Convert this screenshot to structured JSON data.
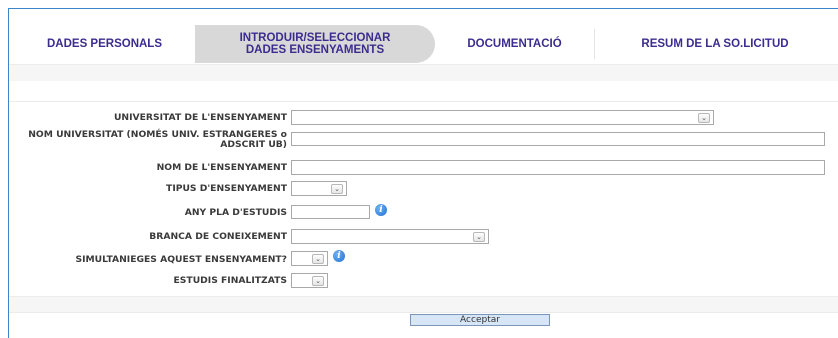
{
  "tabs": [
    {
      "label_line1": "DADES PERSONALS",
      "label_line2": ""
    },
    {
      "label_line1": "INTRODUIR/SELECCIONAR",
      "label_line2": "DADES ENSENYAMENTS"
    },
    {
      "label_line1": "DOCUMENTACIÓ",
      "label_line2": ""
    },
    {
      "label_line1": "RESUM DE LA SO.LICITUD",
      "label_line2": ""
    }
  ],
  "active_tab_index": 1,
  "form": {
    "universitat_label": "UNIVERSITAT DE L'ENSENYAMENT",
    "universitat_value": "",
    "nom_universitat_label_line1": "NOM UNIVERSITAT (NOMÉS UNIV. ESTRANGERES o",
    "nom_universitat_label_line2": "ADSCRIT UB)",
    "nom_universitat_value": "",
    "nom_ensenyament_label": "NOM DE L'ENSENYAMENT",
    "nom_ensenyament_value": "",
    "tipus_label": "TIPUS D'ENSENYAMENT",
    "tipus_value": "",
    "any_pla_label": "ANY PLA D'ESTUDIS",
    "any_pla_value": "",
    "branca_label": "BRANCA DE CONEIXEMENT",
    "branca_value": "",
    "simultanieges_label": "SIMULTANIEGES AQUEST ENSENYAMENT?",
    "simultanieges_value": "",
    "estudis_label": "ESTUDIS FINALITZATS",
    "estudis_value": ""
  },
  "accept_label": "Acceptar",
  "colors": {
    "tab_text": "#3b2c8f",
    "active_tab_bg": "#d8d8d8",
    "frame_border": "#3a86c8",
    "label_text": "#3a3a3a",
    "accept_bg": "#d7e6f6"
  },
  "icons": {
    "select_arrow": "chevron-down-icon",
    "info": "info-icon"
  }
}
